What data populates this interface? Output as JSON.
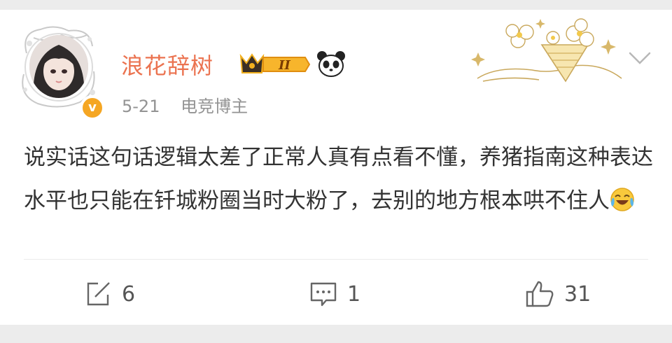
{
  "user": {
    "name": "浪花辞树",
    "date": "5-21",
    "tag": "电竞博主",
    "vip_level": "II",
    "verified_mark": "v"
  },
  "post": {
    "text": "说实话这句话逻辑太差了正常人真有点看不懂，养猪指南这种表达水平也只能在钎城粉圈当时大粉了，去别的地方根本哄不住人",
    "emoji": "laugh-cry-emoji"
  },
  "actions": {
    "repost_count": "6",
    "comment_count": "1",
    "like_count": "31"
  },
  "colors": {
    "username": "#eb7350",
    "verified": "#f5a623",
    "meta": "#939393",
    "text": "#333333"
  },
  "icons": [
    "avatar-frame-icon",
    "vip-crown-badge-icon",
    "panda-icon",
    "flower-bouquet-decoration",
    "chevron-down-icon",
    "repost-icon",
    "comment-icon",
    "like-icon"
  ]
}
